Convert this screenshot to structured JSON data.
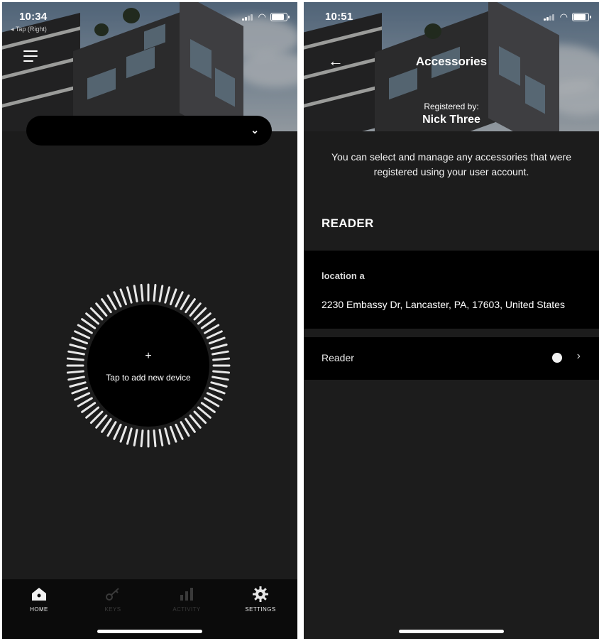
{
  "left_screen": {
    "status": {
      "time": "10:34",
      "back_app": "◂ Tap (Right)"
    },
    "hamburger_icon": "menu-icon",
    "selector": {
      "label": "",
      "icon": "chevron-down-icon"
    },
    "dial": {
      "plus": "+",
      "label": "Tap to add new device"
    },
    "tabs": [
      {
        "label": "HOME",
        "icon": "home-icon",
        "active": true
      },
      {
        "label": "KEYS",
        "icon": "key-icon",
        "active": false
      },
      {
        "label": "ACTIVITY",
        "icon": "activity-icon",
        "active": false
      },
      {
        "label": "SETTINGS",
        "icon": "gear-icon",
        "active": true
      }
    ]
  },
  "right_screen": {
    "status": {
      "time": "10:51"
    },
    "header": {
      "title": "Accessories",
      "back_icon": "arrow-left-icon"
    },
    "registered_by_label": "Registered by:",
    "registered_by_name": "Nick Three",
    "description": "You can select and manage any accessories that were registered using your user account.",
    "section_title": "READER",
    "location": {
      "name": "location a",
      "address": "2230 Embassy Dr, Lancaster, PA, 17603, United States"
    },
    "reader_row": {
      "label": "Reader",
      "status_color": "#f2f2f2"
    }
  },
  "colors": {
    "background": "#1c1c1c",
    "panel": "#000000",
    "text": "#ffffff",
    "tab_inactive": "#3a3a3a"
  }
}
